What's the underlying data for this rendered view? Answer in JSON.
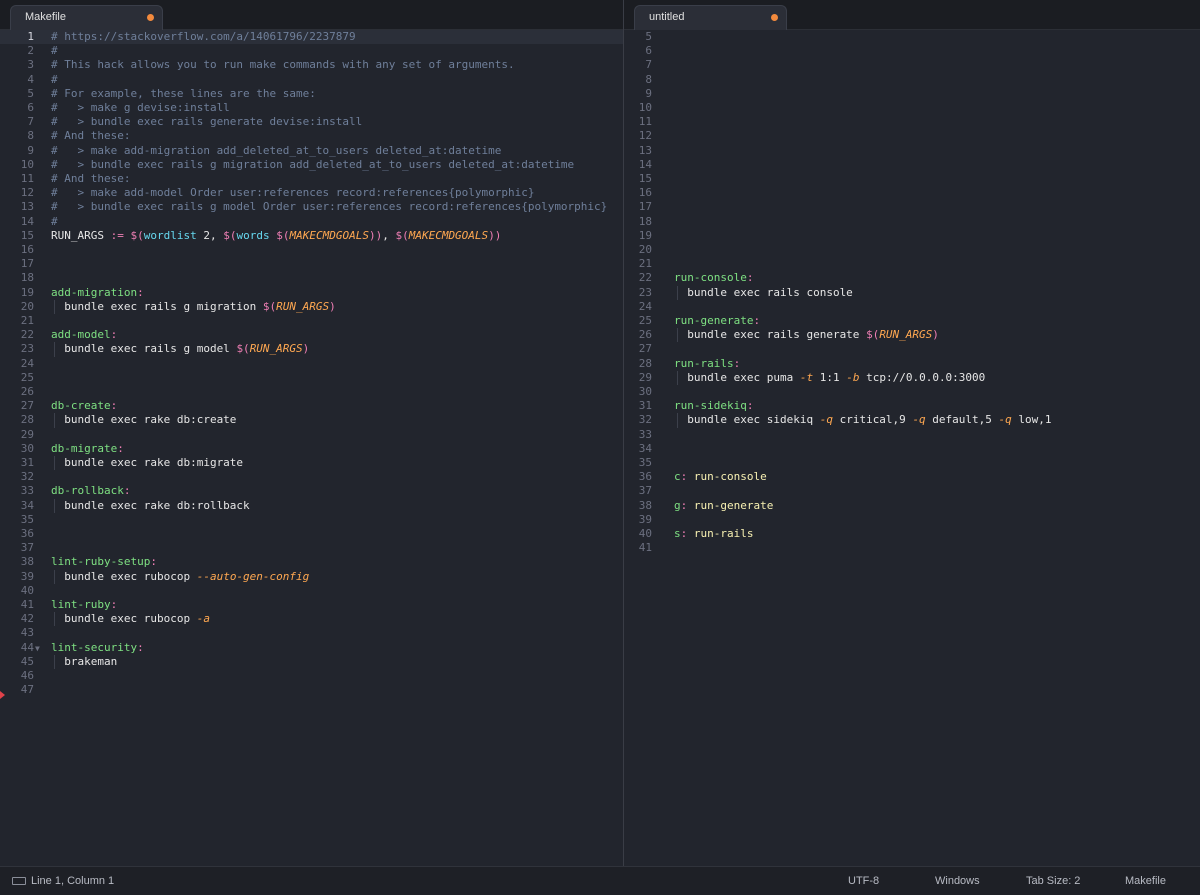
{
  "tabs": {
    "left": {
      "label": "Makefile",
      "modified": true
    },
    "right": {
      "label": "untitled",
      "modified": true
    }
  },
  "colors": {
    "background": "#22252d",
    "comment": "#6f7f9a",
    "target": "#7ee082",
    "operator": "#f07fb5",
    "function": "#ffa851",
    "modified_dot": "#f38a3d"
  },
  "left_editor": {
    "current_line": 1,
    "lines": [
      {
        "n": "1",
        "tokens": [
          {
            "t": "# https://stackoverflow.com/a/14061796/2237879",
            "c": "comment"
          }
        ]
      },
      {
        "n": "2",
        "tokens": [
          {
            "t": "#",
            "c": "comment"
          }
        ]
      },
      {
        "n": "3",
        "tokens": [
          {
            "t": "# This hack allows you to run make commands with any set of arguments.",
            "c": "comment"
          }
        ]
      },
      {
        "n": "4",
        "tokens": [
          {
            "t": "#",
            "c": "comment"
          }
        ]
      },
      {
        "n": "5",
        "tokens": [
          {
            "t": "# For example, these lines are the same:",
            "c": "comment"
          }
        ]
      },
      {
        "n": "6",
        "tokens": [
          {
            "t": "#   > make g devise:install",
            "c": "comment"
          }
        ]
      },
      {
        "n": "7",
        "tokens": [
          {
            "t": "#   > bundle exec rails generate devise:install",
            "c": "comment"
          }
        ]
      },
      {
        "n": "8",
        "tokens": [
          {
            "t": "# And these:",
            "c": "comment"
          }
        ]
      },
      {
        "n": "9",
        "tokens": [
          {
            "t": "#   > make add-migration add_deleted_at_to_users deleted_at:datetime",
            "c": "comment"
          }
        ]
      },
      {
        "n": "10",
        "tokens": [
          {
            "t": "#   > bundle exec rails g migration add_deleted_at_to_users deleted_at:datetime",
            "c": "comment"
          }
        ]
      },
      {
        "n": "11",
        "tokens": [
          {
            "t": "# And these:",
            "c": "comment"
          }
        ]
      },
      {
        "n": "12",
        "tokens": [
          {
            "t": "#   > make add-model Order user:references record:references{polymorphic}",
            "c": "comment"
          }
        ]
      },
      {
        "n": "13",
        "tokens": [
          {
            "t": "#   > bundle exec rails g model Order user:references record:references{polymorphic}",
            "c": "comment"
          }
        ]
      },
      {
        "n": "14",
        "tokens": [
          {
            "t": "#",
            "c": "comment"
          }
        ]
      },
      {
        "n": "15",
        "tokens": [
          {
            "t": "RUN_ARGS ",
            "c": "plain"
          },
          {
            "t": ":=",
            "c": "op"
          },
          {
            "t": " ",
            "c": "plain"
          },
          {
            "t": "$(",
            "c": "op"
          },
          {
            "t": "wordlist",
            "c": "builtin"
          },
          {
            "t": " 2, ",
            "c": "plain"
          },
          {
            "t": "$(",
            "c": "op"
          },
          {
            "t": "words",
            "c": "builtin"
          },
          {
            "t": " ",
            "c": "plain"
          },
          {
            "t": "$(",
            "c": "op"
          },
          {
            "t": "MAKECMDGOALS",
            "c": "func"
          },
          {
            "t": "))",
            "c": "op"
          },
          {
            "t": ", ",
            "c": "plain"
          },
          {
            "t": "$(",
            "c": "op"
          },
          {
            "t": "MAKECMDGOALS",
            "c": "func"
          },
          {
            "t": "))",
            "c": "op"
          }
        ]
      },
      {
        "n": "16",
        "tokens": []
      },
      {
        "n": "17",
        "tokens": []
      },
      {
        "n": "18",
        "tokens": []
      },
      {
        "n": "19",
        "tokens": [
          {
            "t": "add-migration",
            "c": "target"
          },
          {
            "t": ":",
            "c": "op"
          }
        ]
      },
      {
        "n": "20",
        "indent": true,
        "tokens": [
          {
            "t": "  bundle exec rails g migration ",
            "c": "plain"
          },
          {
            "t": "$(",
            "c": "op"
          },
          {
            "t": "RUN_ARGS",
            "c": "func"
          },
          {
            "t": ")",
            "c": "op"
          }
        ]
      },
      {
        "n": "21",
        "tokens": []
      },
      {
        "n": "22",
        "tokens": [
          {
            "t": "add-model",
            "c": "target"
          },
          {
            "t": ":",
            "c": "op"
          }
        ]
      },
      {
        "n": "23",
        "indent": true,
        "tokens": [
          {
            "t": "  bundle exec rails g model ",
            "c": "plain"
          },
          {
            "t": "$(",
            "c": "op"
          },
          {
            "t": "RUN_ARGS",
            "c": "func"
          },
          {
            "t": ")",
            "c": "op"
          }
        ]
      },
      {
        "n": "24",
        "tokens": []
      },
      {
        "n": "25",
        "tokens": []
      },
      {
        "n": "26",
        "tokens": []
      },
      {
        "n": "27",
        "tokens": [
          {
            "t": "db-create",
            "c": "target"
          },
          {
            "t": ":",
            "c": "op"
          }
        ]
      },
      {
        "n": "28",
        "indent": true,
        "tokens": [
          {
            "t": "  bundle exec rake db:create",
            "c": "plain"
          }
        ]
      },
      {
        "n": "29",
        "tokens": []
      },
      {
        "n": "30",
        "tokens": [
          {
            "t": "db-migrate",
            "c": "target"
          },
          {
            "t": ":",
            "c": "op"
          }
        ]
      },
      {
        "n": "31",
        "indent": true,
        "tokens": [
          {
            "t": "  bundle exec rake db:migrate",
            "c": "plain"
          }
        ]
      },
      {
        "n": "32",
        "tokens": []
      },
      {
        "n": "33",
        "tokens": [
          {
            "t": "db-rollback",
            "c": "target"
          },
          {
            "t": ":",
            "c": "op"
          }
        ]
      },
      {
        "n": "34",
        "indent": true,
        "tokens": [
          {
            "t": "  bundle exec rake db:rollback",
            "c": "plain"
          }
        ]
      },
      {
        "n": "35",
        "tokens": []
      },
      {
        "n": "36",
        "tokens": []
      },
      {
        "n": "37",
        "tokens": []
      },
      {
        "n": "38",
        "tokens": [
          {
            "t": "lint-ruby-setup",
            "c": "target"
          },
          {
            "t": ":",
            "c": "op"
          }
        ]
      },
      {
        "n": "39",
        "indent": true,
        "tokens": [
          {
            "t": "  bundle exec rubocop ",
            "c": "plain"
          },
          {
            "t": "--auto-gen-config",
            "c": "func"
          }
        ]
      },
      {
        "n": "40",
        "tokens": []
      },
      {
        "n": "41",
        "tokens": [
          {
            "t": "lint-ruby",
            "c": "target"
          },
          {
            "t": ":",
            "c": "op"
          }
        ]
      },
      {
        "n": "42",
        "indent": true,
        "tokens": [
          {
            "t": "  bundle exec rubocop ",
            "c": "plain"
          },
          {
            "t": "-a",
            "c": "func"
          }
        ]
      },
      {
        "n": "43",
        "tokens": []
      },
      {
        "n": "44",
        "fold": true,
        "tokens": [
          {
            "t": "lint-security",
            "c": "target"
          },
          {
            "t": ":",
            "c": "op"
          }
        ]
      },
      {
        "n": "45",
        "indent": true,
        "tokens": [
          {
            "t": "  brakeman",
            "c": "plain"
          }
        ]
      },
      {
        "n": "46",
        "tokens": []
      },
      {
        "n": "47",
        "tokens": []
      }
    ]
  },
  "right_editor": {
    "lines": [
      {
        "n": "5",
        "tokens": []
      },
      {
        "n": "6",
        "tokens": []
      },
      {
        "n": "7",
        "tokens": []
      },
      {
        "n": "8",
        "tokens": []
      },
      {
        "n": "9",
        "tokens": []
      },
      {
        "n": "10",
        "tokens": []
      },
      {
        "n": "11",
        "tokens": []
      },
      {
        "n": "12",
        "tokens": []
      },
      {
        "n": "13",
        "tokens": []
      },
      {
        "n": "14",
        "tokens": []
      },
      {
        "n": "15",
        "tokens": []
      },
      {
        "n": "16",
        "tokens": []
      },
      {
        "n": "17",
        "tokens": []
      },
      {
        "n": "18",
        "tokens": []
      },
      {
        "n": "19",
        "tokens": []
      },
      {
        "n": "20",
        "tokens": []
      },
      {
        "n": "21",
        "tokens": []
      },
      {
        "n": "22",
        "tokens": [
          {
            "t": "run-console",
            "c": "target"
          },
          {
            "t": ":",
            "c": "op"
          }
        ]
      },
      {
        "n": "23",
        "indent": true,
        "tokens": [
          {
            "t": "  bundle exec rails console",
            "c": "plain"
          }
        ]
      },
      {
        "n": "24",
        "tokens": []
      },
      {
        "n": "25",
        "tokens": [
          {
            "t": "run-generate",
            "c": "target"
          },
          {
            "t": ":",
            "c": "op"
          }
        ]
      },
      {
        "n": "26",
        "indent": true,
        "tokens": [
          {
            "t": "  bundle exec rails generate ",
            "c": "plain"
          },
          {
            "t": "$(",
            "c": "op"
          },
          {
            "t": "RUN_ARGS",
            "c": "func"
          },
          {
            "t": ")",
            "c": "op"
          }
        ]
      },
      {
        "n": "27",
        "tokens": []
      },
      {
        "n": "28",
        "tokens": [
          {
            "t": "run-rails",
            "c": "target"
          },
          {
            "t": ":",
            "c": "op"
          }
        ]
      },
      {
        "n": "29",
        "indent": true,
        "tokens": [
          {
            "t": "  bundle exec puma ",
            "c": "plain"
          },
          {
            "t": "-t",
            "c": "func"
          },
          {
            "t": " 1:1 ",
            "c": "plain"
          },
          {
            "t": "-b",
            "c": "func"
          },
          {
            "t": " tcp://0.0.0.0:3000",
            "c": "plain"
          }
        ]
      },
      {
        "n": "30",
        "tokens": []
      },
      {
        "n": "31",
        "tokens": [
          {
            "t": "run-sidekiq",
            "c": "target"
          },
          {
            "t": ":",
            "c": "op"
          }
        ]
      },
      {
        "n": "32",
        "indent": true,
        "tokens": [
          {
            "t": "  bundle exec sidekiq ",
            "c": "plain"
          },
          {
            "t": "-q",
            "c": "func"
          },
          {
            "t": " critical,9 ",
            "c": "plain"
          },
          {
            "t": "-q",
            "c": "func"
          },
          {
            "t": " default,5 ",
            "c": "plain"
          },
          {
            "t": "-q",
            "c": "func"
          },
          {
            "t": " low,1",
            "c": "plain"
          }
        ]
      },
      {
        "n": "33",
        "tokens": []
      },
      {
        "n": "34",
        "tokens": []
      },
      {
        "n": "35",
        "tokens": []
      },
      {
        "n": "36",
        "tokens": [
          {
            "t": "c",
            "c": "target"
          },
          {
            "t": ":",
            "c": "op"
          },
          {
            "t": " run-console",
            "c": "var"
          }
        ]
      },
      {
        "n": "37",
        "tokens": []
      },
      {
        "n": "38",
        "tokens": [
          {
            "t": "g",
            "c": "target"
          },
          {
            "t": ":",
            "c": "op"
          },
          {
            "t": " run-generate",
            "c": "var"
          }
        ]
      },
      {
        "n": "39",
        "tokens": []
      },
      {
        "n": "40",
        "tokens": [
          {
            "t": "s",
            "c": "target"
          },
          {
            "t": ":",
            "c": "op"
          },
          {
            "t": " run-rails",
            "c": "var"
          }
        ]
      },
      {
        "n": "41",
        "tokens": []
      }
    ]
  },
  "status": {
    "position": "Line 1, Column 1",
    "encoding": "UTF-8",
    "line_endings": "Windows",
    "tab_size": "Tab Size: 2",
    "syntax": "Makefile"
  }
}
